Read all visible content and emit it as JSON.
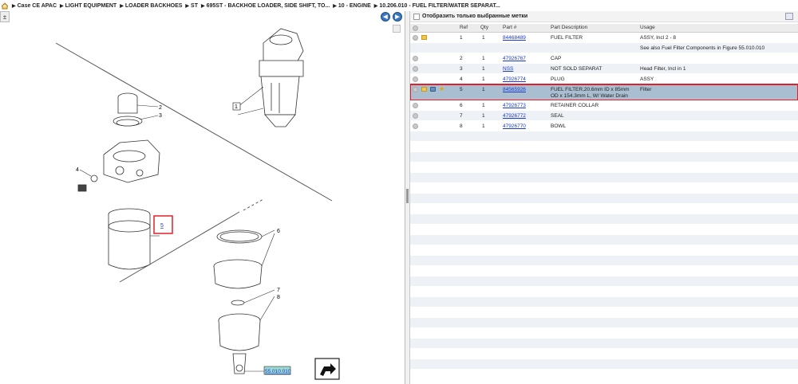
{
  "breadcrumb": [
    {
      "label": "Case CE APAC"
    },
    {
      "label": "LIGHT EQUIPMENT"
    },
    {
      "label": "LOADER BACKHOES"
    },
    {
      "label": "ST"
    },
    {
      "label": "695ST - BACKHOE LOADER, SIDE SHIFT, TO..."
    },
    {
      "label": "10 - ENGINE"
    },
    {
      "label": "10.206.010 - FUEL FILTER/WATER SEPARAT..."
    }
  ],
  "diagram": {
    "callouts": [
      "1",
      "2",
      "3",
      "4",
      "5",
      "6",
      "7",
      "8"
    ],
    "highlighted_ref": "5",
    "figure_ref": "55.010.010"
  },
  "parts_panel": {
    "filter_label": "Отобразить только выбранные метки",
    "columns": {
      "ref": "Ref",
      "qty": "Qty",
      "part": "Part #",
      "desc": "Part Description",
      "usage": "Usage"
    },
    "rows": [
      {
        "ref": "1",
        "qty": "1",
        "part": "84468489",
        "desc": "FUEL FILTER",
        "usage": "ASSY, Incl 2 - 8",
        "icons": [
          "folder"
        ]
      },
      {
        "ref": "",
        "qty": "",
        "part": "",
        "desc": "",
        "usage": "See also Fuel Filter Components in Figure 55.010.010",
        "icons": []
      },
      {
        "ref": "2",
        "qty": "1",
        "part": "47926767",
        "desc": "CAP",
        "usage": "",
        "icons": []
      },
      {
        "ref": "3",
        "qty": "1",
        "part": "NSS",
        "desc": "NOT SOLD SEPARAT",
        "usage": "Head Filter, Incl in 1",
        "icons": []
      },
      {
        "ref": "4",
        "qty": "1",
        "part": "47926774",
        "desc": "PLUG",
        "usage": "ASSY",
        "icons": []
      },
      {
        "ref": "5",
        "qty": "1",
        "part": "84565926",
        "desc": "FUEL FILTER,20.6mm ID x 85mm OD x 154.3mm L, W/ Water Drain",
        "usage": "Filter",
        "icons": [
          "folder",
          "tool",
          "star"
        ],
        "selected": true
      },
      {
        "ref": "6",
        "qty": "1",
        "part": "47926773",
        "desc": "RETAINER COLLAR",
        "usage": "",
        "icons": []
      },
      {
        "ref": "7",
        "qty": "1",
        "part": "47926772",
        "desc": "SEAL",
        "usage": "",
        "icons": []
      },
      {
        "ref": "8",
        "qty": "1",
        "part": "47926770",
        "desc": "BOWL",
        "usage": "",
        "icons": []
      }
    ]
  }
}
